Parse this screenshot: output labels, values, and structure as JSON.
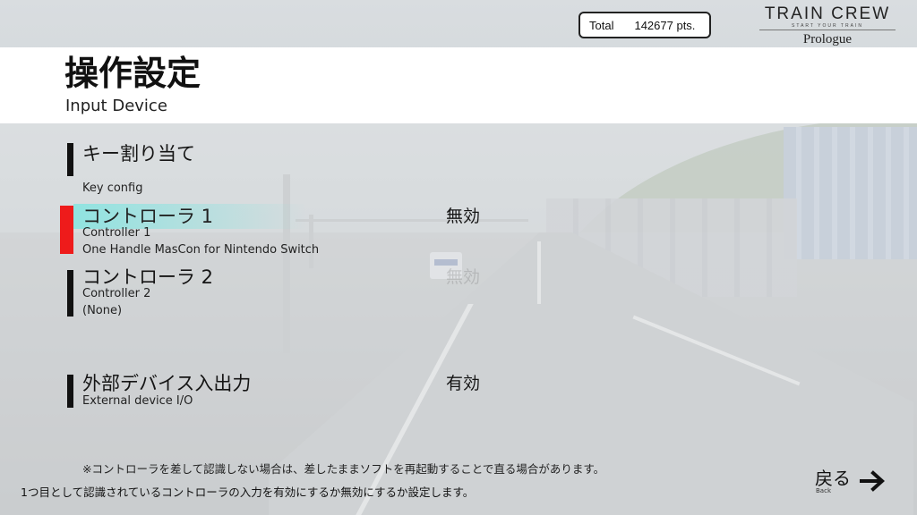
{
  "score": {
    "label": "Total",
    "value": "142677 pts."
  },
  "logo": {
    "title": "TRAIN CREW",
    "tagline": "START YOUR TRAIN",
    "edition": "Prologue"
  },
  "header": {
    "title": "操作設定",
    "subtitle": "Input Device"
  },
  "items": [
    {
      "name": "キー割り当て",
      "sub1": "Key config",
      "sub2": "",
      "value": "",
      "selected": false
    },
    {
      "name": "コントローラ 1",
      "sub1": "Controller 1",
      "sub2": "One Handle MasCon for Nintendo Switch",
      "value": "無効",
      "selected": true
    },
    {
      "name": "コントローラ 2",
      "sub1": "Controller 2",
      "sub2": "(None)",
      "value": "無効",
      "selected": false
    },
    {
      "name": "外部デバイス入出力",
      "sub1": "External device I/O",
      "sub2": "",
      "value": "有効",
      "selected": false
    }
  ],
  "note": "※コントローラを差して認識しない場合は、差したままソフトを再起動することで直る場合があります。",
  "help_text": "1つ目として認識されているコントローラの入力を有効にするか無効にするか設定します。",
  "back": {
    "label": "戻る",
    "sub": "Back",
    "icon": "arrow-right-icon"
  },
  "colors": {
    "selected_bar": "#ee1b1b",
    "highlight": "#78e6e1",
    "bar": "#111111"
  }
}
